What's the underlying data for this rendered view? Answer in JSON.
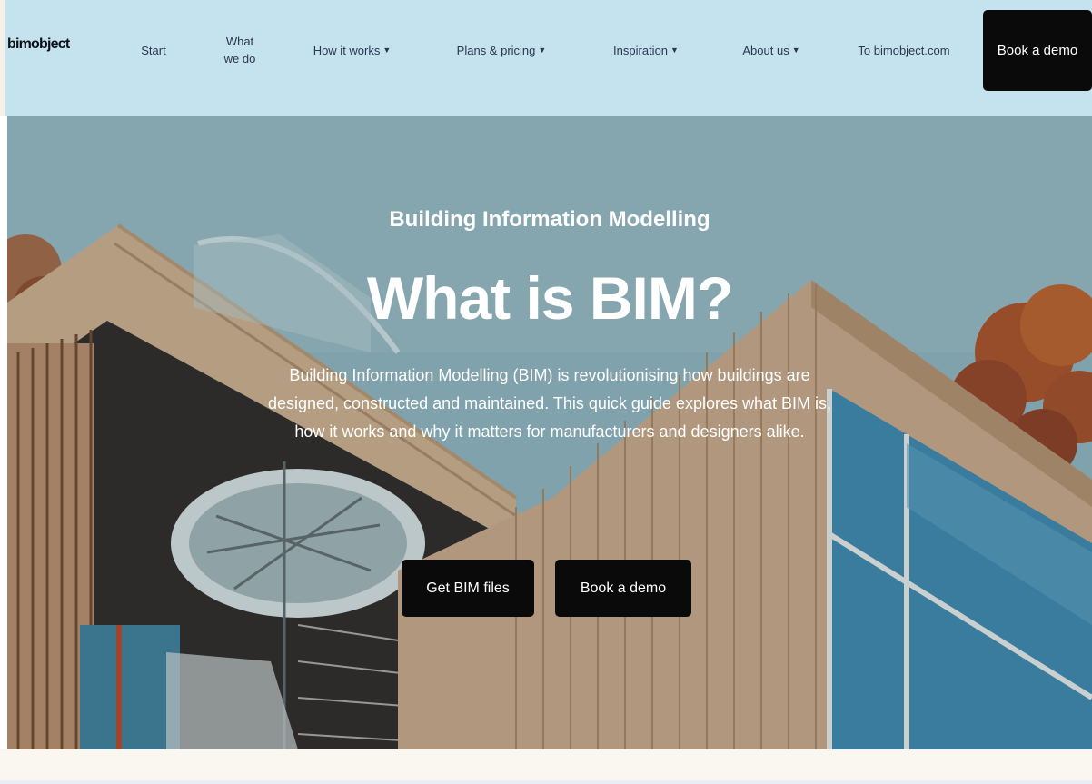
{
  "nav": {
    "logo": "bimobject",
    "items": [
      {
        "label": "Start"
      },
      {
        "label": "What we do"
      },
      {
        "label": "How it works"
      },
      {
        "label": "Plans & pricing"
      },
      {
        "label": "Inspiration"
      },
      {
        "label": "About us"
      },
      {
        "label": "To bimobject.com"
      }
    ],
    "cta": "Book a demo",
    "chevron_icon": "chevron-down-icon"
  },
  "hero": {
    "eyebrow": "Building Information Modelling",
    "title": "What is BIM?",
    "description": "Building Information Modelling (BIM) is revolutionising how buildings are designed, constructed and maintained. This quick guide explores what BIM is, how it works and why it matters for manufacturers and designers alike.",
    "primary_button": "Get BIM files",
    "secondary_button": "Book a demo"
  },
  "colors": {
    "nav_bg": "#c4e3ee",
    "button_bg": "#0a0a0a",
    "text_dark": "#2b3650",
    "page_bottom": "#faf7f1"
  }
}
